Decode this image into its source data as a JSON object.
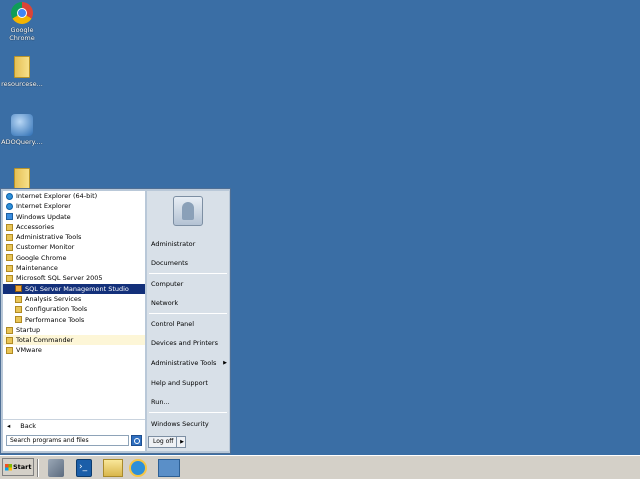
{
  "desktop": {
    "icons": [
      {
        "label": "Google Chrome",
        "icon": "chrome-icon"
      },
      {
        "label": "resourcese...",
        "icon": "folder-icon"
      },
      {
        "label": "ADOQuery....",
        "icon": "database-icon"
      },
      {
        "label": "",
        "icon": "folder-icon"
      }
    ]
  },
  "start_menu": {
    "programs": [
      {
        "label": "Internet Explorer (64-bit)",
        "icon": "ie-icon"
      },
      {
        "label": "Internet Explorer",
        "icon": "ie-icon"
      },
      {
        "label": "Windows Update",
        "icon": "windows-update-icon"
      },
      {
        "label": "Accessories",
        "icon": "folder-icon"
      },
      {
        "label": "Administrative Tools",
        "icon": "folder-icon"
      },
      {
        "label": "Customer Monitor",
        "icon": "folder-icon"
      },
      {
        "label": "Google Chrome",
        "icon": "folder-icon"
      },
      {
        "label": "Maintenance",
        "icon": "folder-icon"
      },
      {
        "label": "Microsoft SQL Server 2005",
        "icon": "folder-icon"
      },
      {
        "label": "SQL Server Management Studio",
        "icon": "sql-server-icon"
      },
      {
        "label": "Analysis Services",
        "icon": "folder-icon"
      },
      {
        "label": "Configuration Tools",
        "icon": "folder-icon"
      },
      {
        "label": "Performance Tools",
        "icon": "folder-icon"
      },
      {
        "label": "Startup",
        "icon": "folder-icon"
      },
      {
        "label": "Total Commander",
        "icon": "folder-icon"
      },
      {
        "label": "VMware",
        "icon": "folder-icon"
      }
    ],
    "back_label": "Back",
    "search_placeholder": "Search programs and files",
    "right_items": [
      {
        "label": "Administrator"
      },
      {
        "label": "Documents"
      },
      {
        "label": "Computer"
      },
      {
        "label": "Network"
      },
      {
        "label": "Control Panel"
      },
      {
        "label": "Devices and Printers"
      },
      {
        "label": "Administrative Tools"
      },
      {
        "label": "Help and Support"
      },
      {
        "label": "Run..."
      },
      {
        "label": "Windows Security"
      }
    ],
    "logoff_label": "Log off"
  },
  "taskbar": {
    "start_label": "Start",
    "pinned": [
      "server-manager-icon",
      "powershell-icon",
      "explorer-icon",
      "ie-icon",
      "network-icon"
    ]
  }
}
